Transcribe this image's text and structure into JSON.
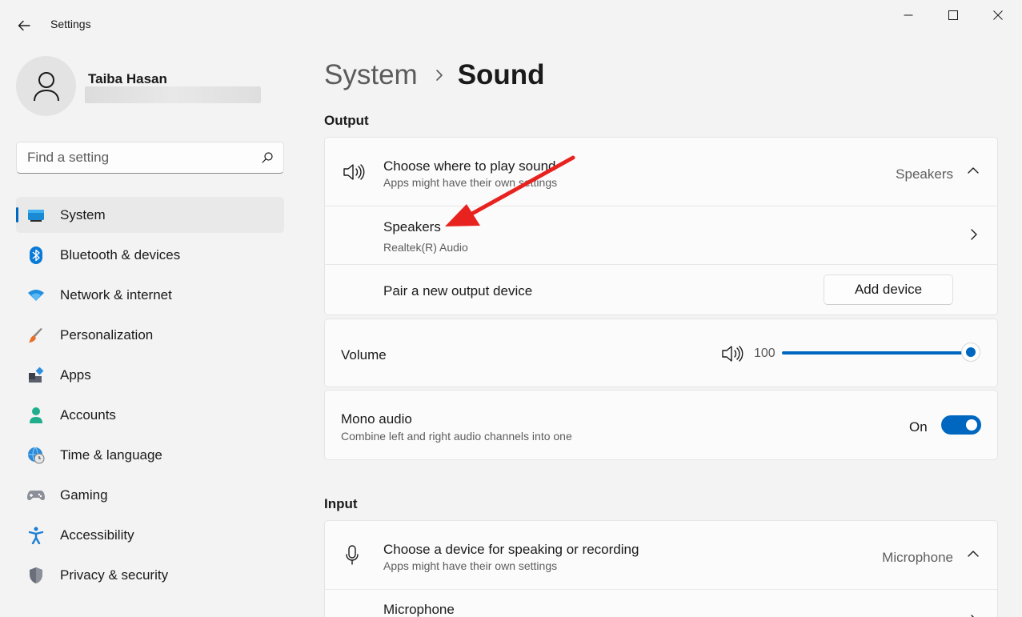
{
  "window": {
    "title": "Settings",
    "back_label": "Back",
    "minimize_label": "Minimize",
    "maximize_label": "Maximize",
    "close_label": "Close"
  },
  "profile": {
    "name": "Taiba Hasan"
  },
  "search": {
    "placeholder": "Find a setting"
  },
  "nav": {
    "items": [
      {
        "label": "System",
        "icon": "monitor-icon",
        "active": true
      },
      {
        "label": "Bluetooth & devices",
        "icon": "bluetooth-icon"
      },
      {
        "label": "Network & internet",
        "icon": "wifi-icon"
      },
      {
        "label": "Personalization",
        "icon": "brush-icon"
      },
      {
        "label": "Apps",
        "icon": "apps-icon"
      },
      {
        "label": "Accounts",
        "icon": "person-icon"
      },
      {
        "label": "Time & language",
        "icon": "globe-clock-icon"
      },
      {
        "label": "Gaming",
        "icon": "gamepad-icon"
      },
      {
        "label": "Accessibility",
        "icon": "accessibility-icon"
      },
      {
        "label": "Privacy & security",
        "icon": "shield-icon"
      }
    ]
  },
  "breadcrumb": {
    "parent": "System",
    "current": "Sound"
  },
  "output": {
    "section_title": "Output",
    "choose": {
      "title": "Choose where to play sound",
      "subtitle": "Apps might have their own settings",
      "value": "Speakers"
    },
    "device": {
      "title": "Speakers",
      "subtitle": "Realtek(R) Audio"
    },
    "pair": {
      "title": "Pair a new output device",
      "button": "Add device"
    },
    "volume": {
      "title": "Volume",
      "value": "100",
      "level_percent": 100
    },
    "mono": {
      "title": "Mono audio",
      "subtitle": "Combine left and right audio channels into one",
      "state": "On"
    }
  },
  "input": {
    "section_title": "Input",
    "choose": {
      "title": "Choose a device for speaking or recording",
      "subtitle": "Apps might have their own settings",
      "value": "Microphone"
    },
    "device": {
      "title": "Microphone"
    }
  },
  "colors": {
    "accent": "#0067c0",
    "annotation_arrow": "#e8231f"
  }
}
